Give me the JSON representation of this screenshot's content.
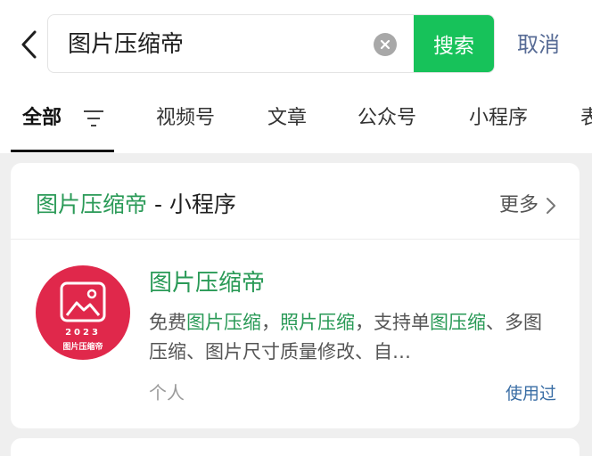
{
  "search": {
    "query": "图片压缩帝",
    "button_label": "搜索",
    "cancel_label": "取消"
  },
  "tabs": [
    {
      "label": "全部",
      "active": true
    },
    {
      "label": "视频号"
    },
    {
      "label": "文章"
    },
    {
      "label": "公众号"
    },
    {
      "label": "小程序"
    },
    {
      "label": "表"
    }
  ],
  "result_card": {
    "title_highlight": "图片压缩帝",
    "title_suffix": " - 小程序",
    "more_label": "更多",
    "app": {
      "name": "图片压缩帝",
      "logo_year": "2023",
      "logo_caption": "图片压缩帝",
      "description_parts": [
        {
          "text": "免费",
          "hl": false
        },
        {
          "text": "图片压缩",
          "hl": true
        },
        {
          "text": "，",
          "hl": false
        },
        {
          "text": "照片压缩",
          "hl": true
        },
        {
          "text": "，支持单",
          "hl": false
        },
        {
          "text": "图压缩",
          "hl": true
        },
        {
          "text": "、多图压缩、图片尺寸质量修改、自…",
          "hl": false
        }
      ],
      "meta": "个人",
      "status": "使用过"
    }
  },
  "colors": {
    "accent_green": "#17c25a",
    "highlight_green": "#2a9a57",
    "link_blue": "#576b95",
    "logo_red": "#e0284b"
  },
  "icons": [
    "back-arrow-icon",
    "clear-icon",
    "filter-icon",
    "chevron-right-icon",
    "image-icon"
  ]
}
